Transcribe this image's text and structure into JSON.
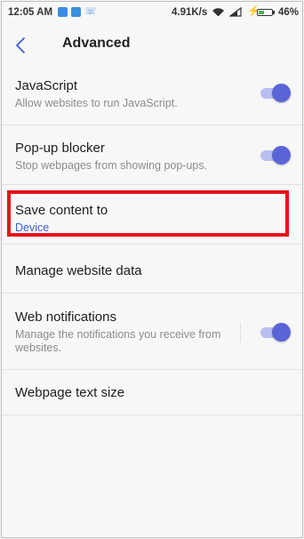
{
  "status_bar": {
    "time": "12:05 AM",
    "speed": "4.91K/s",
    "battery": "46%",
    "battery_level": 0.46,
    "icons": [
      "app-icon",
      "upload-icon",
      "phone-icon",
      "wifi-icon",
      "signal-icon",
      "charging-icon",
      "battery-icon"
    ]
  },
  "header": {
    "back_icon": "chevron-left-icon",
    "title": "Advanced"
  },
  "settings": [
    {
      "label": "JavaScript",
      "desc": "Allow websites to run JavaScript.",
      "toggle": true
    },
    {
      "label": "Pop-up blocker",
      "desc": "Stop webpages from showing pop-ups.",
      "toggle": true
    },
    {
      "label": "Save content to",
      "value": "Device"
    },
    {
      "label": "Manage website data"
    },
    {
      "label": "Web notifications",
      "desc": "Manage the notifications you receive from websites.",
      "toggle": true
    },
    {
      "label": "Webpage text size"
    }
  ],
  "colors": {
    "accent": "#5b64d6",
    "toggle_track": "#b9bff0",
    "highlight": "#e8121a",
    "value_text": "#3d5fd6"
  }
}
